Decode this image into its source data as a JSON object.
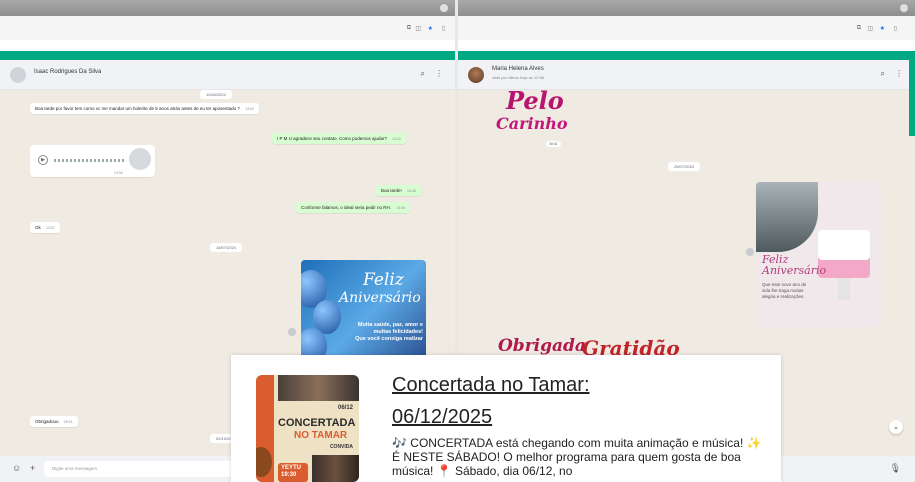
{
  "left": {
    "contact_name": "Isaac Rodrigues Da Silva",
    "date_top": "11/06/2024",
    "messages": [
      {
        "text": "Boa tarde por favor tem como vc me mandar um holerite de 5 anos atrás antes de eu ter aposentado ?",
        "time": "13:02"
      },
      {
        "text": "I P M U agradece seu contato. Como podemos ajudar?",
        "time": "13:02"
      },
      {
        "text": "Boa tarde!",
        "time": "13:45"
      },
      {
        "text": "Conforme falamos, o ideal seria pedir no RH.",
        "time": "13:45"
      },
      {
        "text": "Ok",
        "time": "13:57"
      },
      {
        "text": "Obrigadouu",
        "time": "09:21"
      }
    ],
    "audio_time": "13:56",
    "date_mid": "16/07/2024",
    "date_bottom": "02/10/2024",
    "bday_image": {
      "title1": "Feliz",
      "title2": "Aniversário",
      "body": "Muita saúde, paz, amor e\nmuitas felicidades!\nQue você consiga realizar"
    },
    "composer_placeholder": "Digite uma mensagem"
  },
  "right": {
    "contact_name": "Maria Helena Alves",
    "contact_status": "visto por último hoje às 10:58",
    "sticker1": "Pelo",
    "sticker2": "Carinho",
    "sticker_time": "08:41",
    "date_chip": "25/07/2024",
    "cake_image": {
      "title": "Feliz\nAniversário",
      "body": "Que este novo ano de\nvida lhe traga muitas\nalegria e realizações."
    },
    "sticker3": "Obrigada",
    "sticker4": "Gratidão"
  },
  "popup": {
    "title": "Concertada no Tamar:\n06/12/2025",
    "description": "🎶 CONCERTADA está chegando com muita animação e música! ✨ É NESTE SÁBADO! O melhor programa para quem gosta de boa música! 📍 Sábado, dia 06/12, no",
    "poster": {
      "date": "06/12",
      "line1": "CONCERTADA",
      "line2": "NO TAMAR",
      "line3": "CONVIDA",
      "band": "YEYTU\n19:30"
    }
  },
  "icons": {
    "search": "search-icon",
    "menu": "kebab-menu-icon",
    "emoji": "emoji-icon",
    "attach": "plus-icon",
    "mic": "mic-icon"
  },
  "colors": {
    "accent": "#00a884",
    "outgoing": "#d9fdd3",
    "chat_bg": "#efeae2"
  }
}
